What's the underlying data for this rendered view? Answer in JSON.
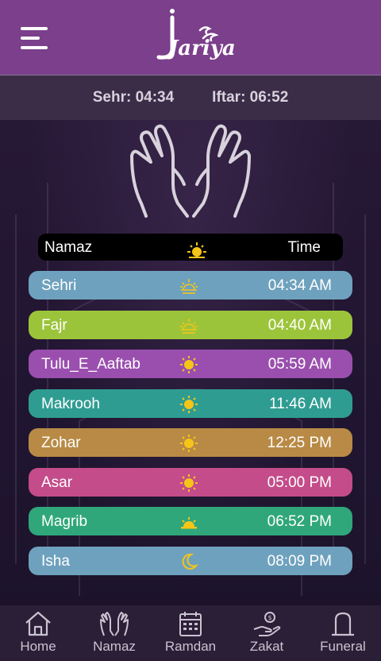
{
  "header": {
    "menu_icon": "hamburger-menu-icon",
    "logo_text": "Jariya"
  },
  "times": {
    "sehr": "Sehr: 04:34",
    "iftar": "Iftar: 06:52"
  },
  "table": {
    "col_name": "Namaz",
    "col_time": "Time",
    "header_icon": "sun-icon"
  },
  "prayers": [
    {
      "name": "Sehri",
      "time": "04:34 AM",
      "color": "#6ea1bd",
      "icon": "sunrise-icon"
    },
    {
      "name": "Fajr",
      "time": "04:40 AM",
      "color": "#9cc43a",
      "icon": "sunrise-icon"
    },
    {
      "name": "Tulu_E_Aaftab",
      "time": "05:59 AM",
      "color": "#9a4fae",
      "icon": "sun-icon"
    },
    {
      "name": "Makrooh",
      "time": "11:46 AM",
      "color": "#2f9c92",
      "icon": "sun-icon"
    },
    {
      "name": "Zohar",
      "time": "12:25 PM",
      "color": "#b88a45",
      "icon": "sun-icon"
    },
    {
      "name": "Asar",
      "time": "05:00 PM",
      "color": "#c44c8a",
      "icon": "sun-icon"
    },
    {
      "name": "Magrib",
      "time": "06:52 PM",
      "color": "#2fa77a",
      "icon": "sunset-icon"
    },
    {
      "name": "Isha",
      "time": "08:09 PM",
      "color": "#6ea1bd",
      "icon": "moon-icon"
    }
  ],
  "nav": [
    {
      "label": "Home",
      "icon": "home-icon"
    },
    {
      "label": "Namaz",
      "icon": "praying-hands-icon"
    },
    {
      "label": "Ramdan",
      "icon": "calendar-icon"
    },
    {
      "label": "Zakat",
      "icon": "charity-hand-icon"
    },
    {
      "label": "Funeral",
      "icon": "grave-icon"
    }
  ],
  "colors": {
    "topbar": "#7b3f8b",
    "sun": "#f5c518",
    "background": "#241733"
  }
}
